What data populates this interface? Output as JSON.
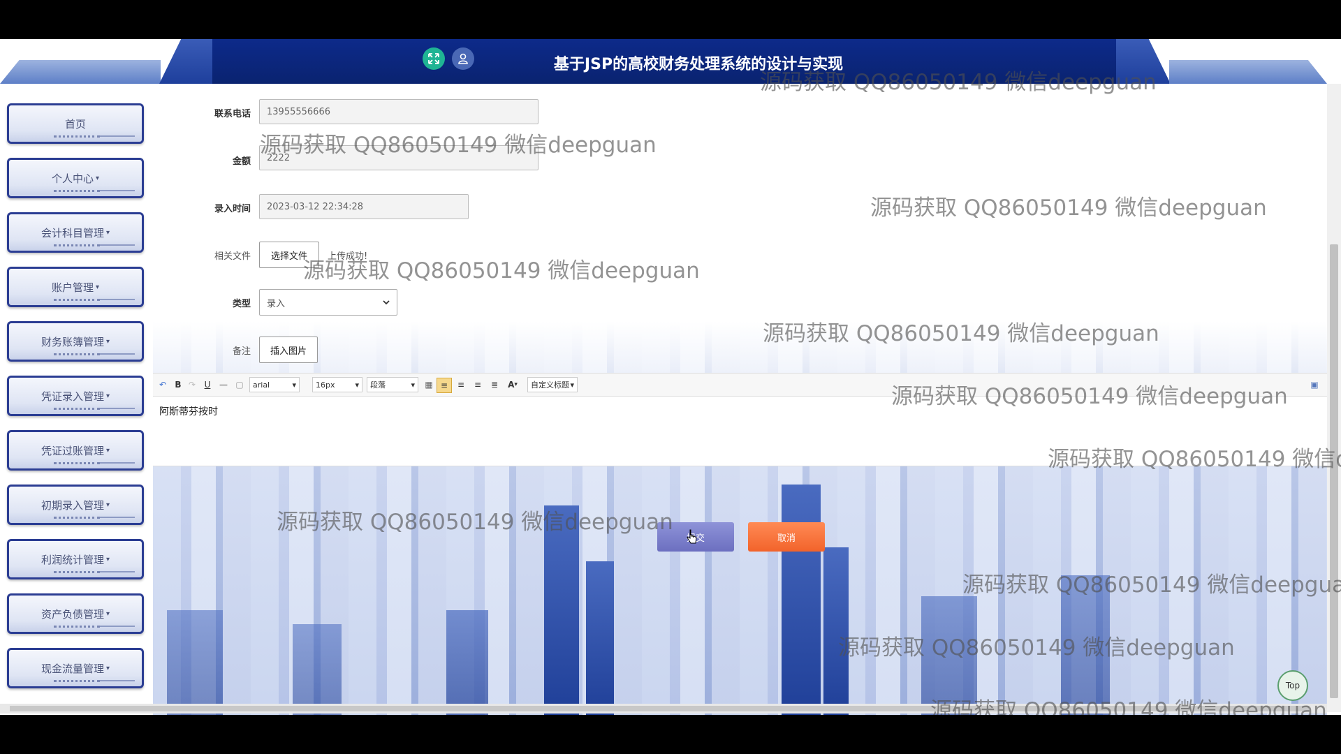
{
  "app": {
    "title": "基于JSP的高校财务处理系统的设计与实现",
    "header_icons": [
      "fullscreen-icon",
      "user-icon"
    ]
  },
  "sidebar": {
    "items": [
      {
        "label": "首页",
        "has_caret": false
      },
      {
        "label": "个人中心",
        "has_caret": true
      },
      {
        "label": "会计科目管理",
        "has_caret": true
      },
      {
        "label": "账户管理",
        "has_caret": true
      },
      {
        "label": "财务账簿管理",
        "has_caret": true
      },
      {
        "label": "凭证录入管理",
        "has_caret": true
      },
      {
        "label": "凭证过账管理",
        "has_caret": true
      },
      {
        "label": "初期录入管理",
        "has_caret": true
      },
      {
        "label": "利润统计管理",
        "has_caret": true
      },
      {
        "label": "资产负债管理",
        "has_caret": true
      },
      {
        "label": "现金流量管理",
        "has_caret": true
      }
    ],
    "caret": "▾"
  },
  "form": {
    "phone": {
      "label": "联系电话",
      "value": "13955556666"
    },
    "amount": {
      "label": "金额",
      "value": "2222"
    },
    "entry_time": {
      "label": "录入时间",
      "value": "2023-03-12 22:34:28"
    },
    "file": {
      "label": "相关文件",
      "button": "选择文件",
      "status": "上传成功!"
    },
    "type": {
      "label": "类型",
      "selected": "录入"
    },
    "remark": {
      "label": "备注",
      "insert_image": "插入图片"
    }
  },
  "editor": {
    "toolbar": {
      "font_family": "arial",
      "font_size": "16px",
      "paragraph": "段落",
      "custom_title": "自定义标题",
      "bold": "B",
      "underline": "U",
      "font_color": "A"
    },
    "content": "阿斯蒂芬按时"
  },
  "actions": {
    "submit": "提交",
    "cancel": "取消",
    "top": "Top"
  },
  "watermark": {
    "text": "源码获取 QQ86050149 微信deepguan"
  },
  "colors": {
    "header": "#0d2a8a",
    "nav_border": "#2b3d93",
    "submit": "#7b7fcc",
    "cancel": "#f26a30",
    "fullscreen_btn": "#1fb494"
  }
}
